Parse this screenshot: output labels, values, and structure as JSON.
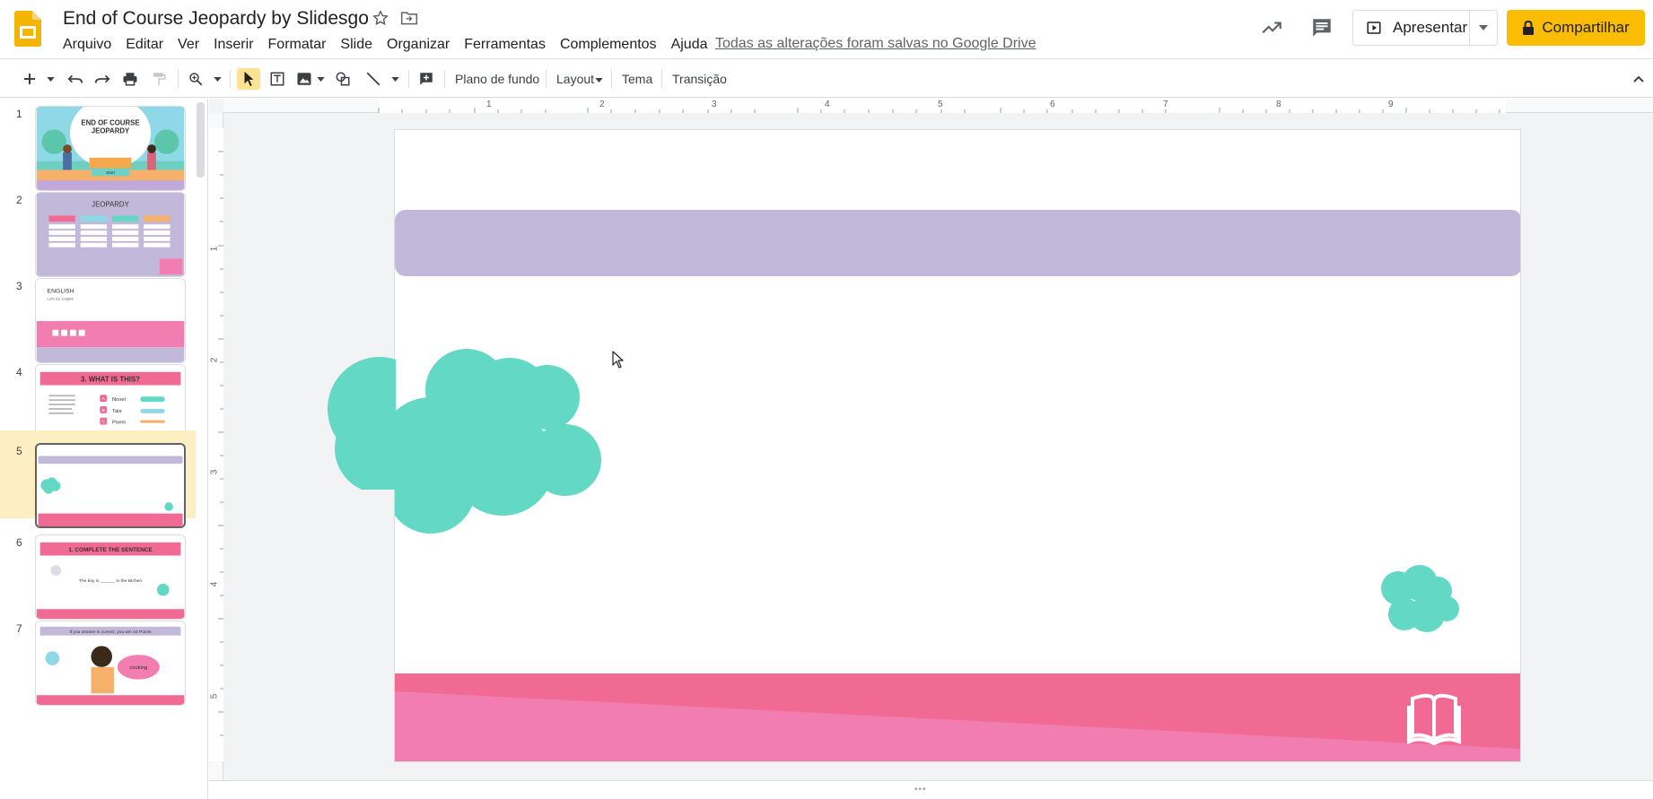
{
  "header": {
    "doc_title": "End of Course Jeopardy by Slidesgo",
    "save_status": "Todas as alterações foram salvas no Google Drive",
    "present_label": "Apresentar",
    "share_label": "Compartilhar"
  },
  "menu": {
    "items": [
      "Arquivo",
      "Editar",
      "Ver",
      "Inserir",
      "Formatar",
      "Slide",
      "Organizar",
      "Ferramentas",
      "Complementos",
      "Ajuda"
    ]
  },
  "toolbar": {
    "background_label": "Plano de fundo",
    "layout_label": "Layout",
    "theme_label": "Tema",
    "transition_label": "Transição"
  },
  "ruler": {
    "h_labels": [
      "1",
      "2",
      "3",
      "4",
      "5",
      "6",
      "7",
      "8",
      "9"
    ],
    "v_labels": [
      "1",
      "2",
      "3",
      "4",
      "5"
    ]
  },
  "filmstrip": {
    "selected_slide": 5,
    "slides": [
      {
        "number": "1",
        "title": "END OF COURSE JEOPARDY",
        "button": "Start"
      },
      {
        "number": "2",
        "title": "JEOPARDY",
        "categories": [
          "ENGLISH",
          "MATH",
          "SCIENCE",
          "ART"
        ],
        "cell": "10 Points"
      },
      {
        "number": "3",
        "title": "ENGLISH",
        "subtitle": "Let's Go, English",
        "cells": [
          "1",
          "2",
          "3",
          "4"
        ]
      },
      {
        "number": "4",
        "title": "3. WHAT IS THIS?",
        "options": [
          "Novel",
          "Tale",
          "Poem"
        ],
        "letters": [
          "A",
          "B",
          "C"
        ]
      },
      {
        "number": "5"
      },
      {
        "number": "6",
        "title": "1. COMPLETE THE SENTENCE",
        "sentence": "The boy is ______ in the kitchen"
      },
      {
        "number": "7",
        "banner": "If you answer is correct, you win 10 Points",
        "bubble": "cooking"
      }
    ]
  },
  "colors": {
    "accent_yellow": "#fbbc04",
    "slide_lavender": "#c2b8d9",
    "slide_pink": "#f06a93",
    "slide_pink_light": "#f27db0",
    "cloud_teal": "#63d8c5"
  }
}
